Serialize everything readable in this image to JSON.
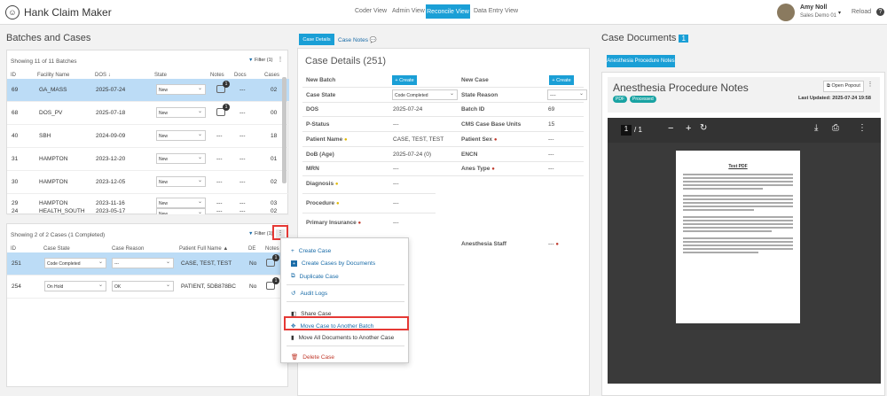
{
  "app": {
    "title": "Hank Claim Maker"
  },
  "nav": {
    "coder": "Coder View",
    "admin": "Admin View",
    "reconcile": "Reconcile View",
    "data_entry": "Data Entry View"
  },
  "user": {
    "name": "Amy Noll",
    "org": "Sales Demo 01",
    "reload": "Reload"
  },
  "batches": {
    "title": "Batches and Cases",
    "showing": "Showing 11 of 11 Batches",
    "filter": "Filter (1)",
    "columns": [
      "ID",
      "Facility Name",
      "DOS",
      "State",
      "Notes",
      "Docs",
      "Cases"
    ],
    "rows": [
      {
        "id": "69",
        "facility": "GA_MASS",
        "dos": "2025-07-24",
        "state": "New",
        "notes": "1",
        "docs": "---",
        "cases": "02"
      },
      {
        "id": "68",
        "facility": "DOS_PV",
        "dos": "2025-07-18",
        "state": "New",
        "notes": "1",
        "docs": "---",
        "cases": "00"
      },
      {
        "id": "40",
        "facility": "SBH",
        "dos": "2024-09-09",
        "state": "New",
        "notes": "---",
        "docs": "---",
        "cases": "18"
      },
      {
        "id": "31",
        "facility": "HAMPTON",
        "dos": "2023-12-20",
        "state": "New",
        "notes": "---",
        "docs": "---",
        "cases": "01"
      },
      {
        "id": "30",
        "facility": "HAMPTON",
        "dos": "2023-12-05",
        "state": "New",
        "notes": "---",
        "docs": "---",
        "cases": "02"
      },
      {
        "id": "29",
        "facility": "HAMPTON",
        "dos": "2023-11-16",
        "state": "New",
        "notes": "---",
        "docs": "---",
        "cases": "03"
      },
      {
        "id": "24",
        "facility": "HEALTH_SOUTH",
        "dos": "2023-05-17",
        "state": "New",
        "notes": "---",
        "docs": "---",
        "cases": "02"
      }
    ]
  },
  "cases": {
    "showing": "Showing 2 of 2 Cases (1 Completed)",
    "filter": "Filter (1)",
    "columns": [
      "ID",
      "Case State",
      "Case Reason",
      "Patient Full Name",
      "DE",
      "Notes"
    ],
    "rows": [
      {
        "id": "251",
        "state": "Code Completed",
        "reason": "---",
        "name": "CASE, TEST, TEST",
        "de": "No",
        "notes": "1"
      },
      {
        "id": "254",
        "state": "On Hold",
        "reason": "OK",
        "name": "PATIENT, 5DB878BC",
        "de": "No",
        "notes": "1"
      }
    ]
  },
  "menu": {
    "create_case": "Create Case",
    "create_by_docs": "Create Cases by Documents",
    "duplicate": "Duplicate Case",
    "audit": "Audit Logs",
    "share": "Share Case",
    "move_batch": "Move Case to Another Batch",
    "move_docs": "Move All Documents to Another Case",
    "delete": "Delete Case"
  },
  "details": {
    "tab_details": "Case Details",
    "tab_notes": "Case Notes",
    "title": "Case Details (251)",
    "create": "+ Create",
    "fields": {
      "new_batch": "New Batch",
      "new_case": "New Case",
      "case_state": "Case State",
      "case_state_val": "Code Completed",
      "state_reason": "State Reason",
      "state_reason_val": "----",
      "dos": "DOS",
      "dos_val": "2025-07-24",
      "batch_id": "Batch ID",
      "batch_id_val": "69",
      "p_status": "P-Status",
      "p_status_val": "---",
      "cms_units": "CMS Case Base Units",
      "cms_units_val": "15",
      "patient_name": "Patient Name",
      "patient_name_val": "CASE, TEST, TEST",
      "patient_sex": "Patient Sex",
      "patient_sex_val": "---",
      "dob": "DoB (Age)",
      "dob_val": "2025-07-24 (0)",
      "encn": "ENCN",
      "encn_val": "---",
      "mrn": "MRN",
      "mrn_val": "---",
      "anes_type": "Anes Type",
      "anes_type_val": "---",
      "diagnosis": "Diagnosis",
      "diagnosis_val": "---",
      "procedure": "Procedure",
      "procedure_val": "---",
      "primary_ins": "Primary Insurance",
      "primary_ins_val": "---",
      "anes_staff": "Anesthesia Staff",
      "anes_staff_val": "---"
    }
  },
  "documents": {
    "title": "Case Documents",
    "count": "1",
    "tab": "Anesthesia Procedure Notes",
    "doc_title": "Anesthesia Procedure Notes",
    "badge_pdf": "PDF",
    "badge_processed": "Processed",
    "open_popout": "Open Popout",
    "last_updated": "Last Updated: 2025-07-24 19:58",
    "page": "1",
    "pages": "/  1",
    "pdf_title": "Test PDF"
  }
}
